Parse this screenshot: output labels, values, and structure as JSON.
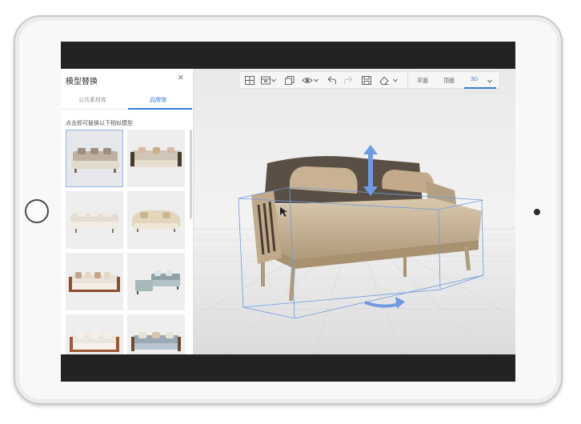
{
  "panel": {
    "title": "模型替换",
    "close_icon": "close-icon",
    "tabs": [
      {
        "label": "公共素材库",
        "active": false
      },
      {
        "label": "品牌馆",
        "active": true
      }
    ],
    "hint": "点击即可替换以下相似模型",
    "items": [
      {
        "icon": "sofa-thumbnail",
        "selected": true
      },
      {
        "icon": "sofa-thumbnail",
        "selected": false
      },
      {
        "icon": "sofa-thumbnail",
        "selected": false
      },
      {
        "icon": "sofa-thumbnail",
        "selected": false
      },
      {
        "icon": "sofa-thumbnail",
        "selected": false
      },
      {
        "icon": "sofa-thumbnail",
        "selected": false
      },
      {
        "icon": "sofa-thumbnail",
        "selected": false
      },
      {
        "icon": "sofa-thumbnail",
        "selected": false
      }
    ]
  },
  "toolbar": {
    "icons": [
      "layout-icon",
      "box-icon",
      "copy-icon",
      "eye-icon",
      "undo-icon",
      "redo-icon",
      "save-icon",
      "eraser-icon"
    ]
  },
  "view_switch": {
    "items": [
      {
        "label": "平面",
        "active": false
      },
      {
        "label": "顶面",
        "active": false
      },
      {
        "label": "3D",
        "active": true
      }
    ]
  },
  "colors": {
    "accent": "#3a7fd5",
    "gizmo": "#6d9be0"
  }
}
